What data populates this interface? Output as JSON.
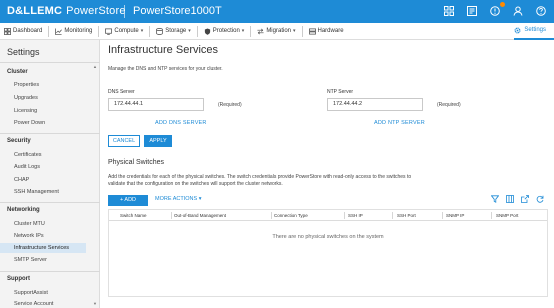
{
  "topbar": {
    "brand": "D&LLEMC",
    "product": "PowerStore",
    "system": "PowerStore1000T",
    "icons": [
      "grid-icon",
      "bell-icon",
      "warning-icon",
      "user-icon",
      "help-icon"
    ],
    "accent": "#1e8bd6"
  },
  "nav": {
    "items": [
      {
        "label": "Dashboard",
        "icon": "dashboard-icon",
        "caret": false
      },
      {
        "label": "Monitoring",
        "icon": "monitoring-icon",
        "caret": false
      },
      {
        "label": "Compute",
        "icon": "compute-icon",
        "caret": true
      },
      {
        "label": "Storage",
        "icon": "storage-icon",
        "caret": true
      },
      {
        "label": "Protection",
        "icon": "protection-icon",
        "caret": true
      },
      {
        "label": "Migration",
        "icon": "migration-icon",
        "caret": true
      },
      {
        "label": "Hardware",
        "icon": "hardware-icon",
        "caret": false
      }
    ],
    "settings": "Settings"
  },
  "sidebar": {
    "title": "Settings",
    "groups": [
      {
        "heading": "Cluster",
        "items": [
          "Properties",
          "Upgrades",
          "Licensing",
          "Power Down"
        ]
      },
      {
        "heading": "Security",
        "items": [
          "Certificates",
          "Audit Logs",
          "CHAP",
          "SSH Management"
        ]
      },
      {
        "heading": "Networking",
        "items": [
          "Cluster MTU",
          "Network IPs",
          "Infrastructure Services",
          "SMTP Server"
        ]
      },
      {
        "heading": "Support",
        "items": [
          "SupportAssist",
          "Service Account"
        ]
      }
    ],
    "active": "Infrastructure Services"
  },
  "main": {
    "title": "Infrastructure Services",
    "description": "Manage the DNS and NTP services for your cluster.",
    "dns": {
      "label": "DNS Server",
      "value": "172.44.44.1",
      "required": "(Required)",
      "add": "ADD DNS SERVER"
    },
    "ntp": {
      "label": "NTP Server",
      "value": "172.44.44.2",
      "required": "(Required)",
      "add": "ADD NTP SERVER"
    },
    "cancel": "CANCEL",
    "apply": "APPLY",
    "switches": {
      "title": "Physical Switches",
      "description": "Add the credentials for each of the physical switches. The switch credentials provide PowerStore with read-only access to the switches to validate that the configuration on the switches will support the cluster networks.",
      "add": "+ ADD",
      "more": "MORE ACTIONS",
      "columns": [
        "Switch Name",
        "Out-of-Band Management",
        "Connection Type",
        "SSH IP",
        "SSH Port",
        "SNMP IP",
        "SNMP Port"
      ],
      "empty": "There are no physical switches on the system"
    }
  }
}
